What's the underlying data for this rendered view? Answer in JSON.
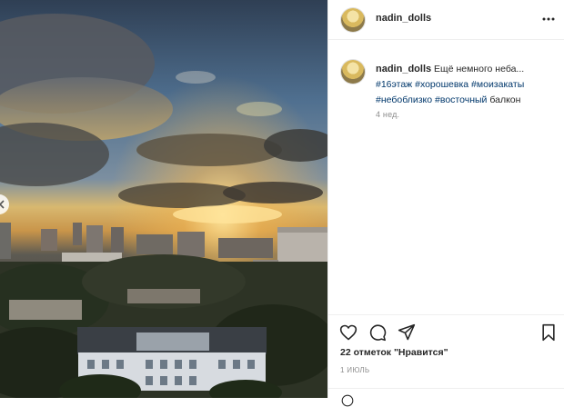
{
  "post": {
    "username": "nadin_dolls",
    "caption_lead": "Ещё немного неба...",
    "hashtags": [
      "#16этаж",
      "#хорошевка",
      "#моизакаты",
      "#небоблизко",
      "#восточный",
      "балкон"
    ],
    "time_ago": "4 нед.",
    "likes_text": "22 отметок \"Нравится\"",
    "date": "1 ИЮЛЬ"
  },
  "icons": {
    "more": "more-options-icon",
    "like": "heart-icon",
    "comment": "comment-icon",
    "share": "share-icon",
    "save": "bookmark-icon",
    "prev": "chevron-left-icon"
  },
  "colors": {
    "hashtag": "#00376b",
    "meta": "#8e8e8e",
    "text": "#262626"
  }
}
